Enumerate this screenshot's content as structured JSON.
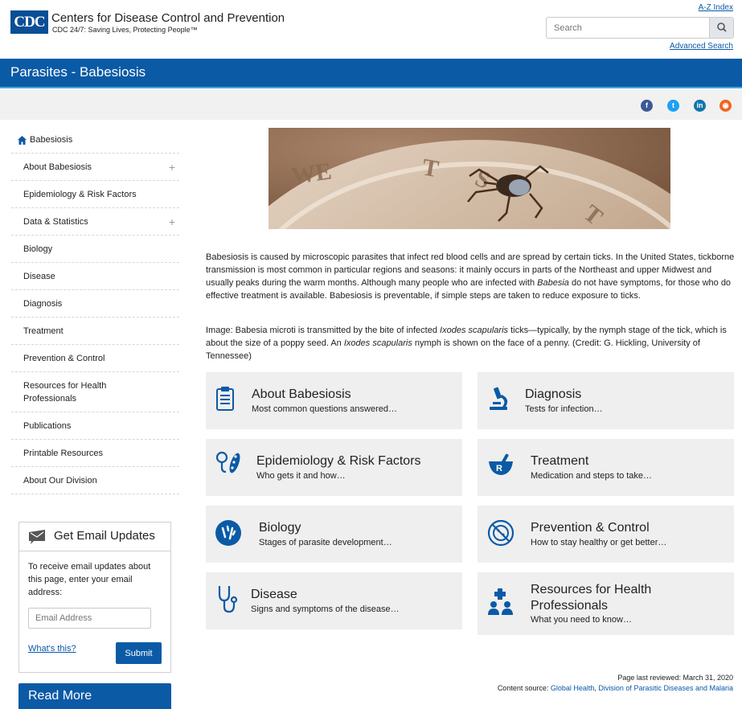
{
  "header": {
    "logo_text": "CDC",
    "org_name": "Centers for Disease Control and Prevention",
    "tagline": "CDC 24/7: Saving Lives, Protecting People™",
    "az_index": "A-Z Index",
    "search_placeholder": "Search",
    "advanced_search": "Advanced Search"
  },
  "band": {
    "title": "Parasites - Babesiosis",
    "color": "#0b5aa6"
  },
  "social": [
    "facebook-icon",
    "twitter-icon",
    "linkedin-icon",
    "syndicate-icon"
  ],
  "sidebar": {
    "home": "Babesiosis",
    "items": [
      {
        "label": "About Babesiosis"
      },
      {
        "label": "Epidemiology & Risk Factors"
      },
      {
        "label": "Data & Statistics"
      },
      {
        "label": "Biology"
      },
      {
        "label": "Disease"
      },
      {
        "label": "Diagnosis"
      },
      {
        "label": "Treatment"
      },
      {
        "label": "Prevention & Control"
      },
      {
        "label": "Resources for Health Professionals"
      },
      {
        "label": "Publications"
      },
      {
        "label": "Printable Resources"
      },
      {
        "label": "About Our Division"
      }
    ],
    "expand_symbol": "+"
  },
  "email": {
    "title": "Get Email Updates",
    "body": "To receive email updates about this page, enter your email address:",
    "placeholder": "Email Address",
    "whats_this": "What's this?",
    "submit": "Submit"
  },
  "read_more": "Read More",
  "main": {
    "intro_1": "Babesiosis is caused by microscopic parasites that infect red blood cells and are spread by certain ticks. In the United States, tickborne transmission is most common in particular regions and seasons: it mainly occurs in parts of the Northeast and upper Midwest and usually peaks during the warm months. Although many people who are infected with ",
    "intro_em": "Babesia",
    "intro_2": " do not have symptoms, for those who do effective treatment is available. Babesiosis is preventable, if simple steps are taken to reduce exposure to ticks.",
    "caption_1": "Image: Babesia microti is transmitted by the bite of infected ",
    "caption_em1": "Ixodes scapularis",
    "caption_2": " ticks—typically, by the nymph stage of the tick, which is about the size of a poppy seed. An ",
    "caption_em2": "Ixodes scapularis",
    "caption_3": " nymph is shown on the face of a penny. (Credit: G. Hickling, University of Tennessee)",
    "cards": [
      {
        "title": "About Babesiosis",
        "sub": "Most common questions answered…"
      },
      {
        "title": "Diagnosis",
        "sub": "Tests for infection…"
      },
      {
        "title": "Epidemiology & Risk Factors",
        "sub": "Who gets it and how…"
      },
      {
        "title": "Treatment",
        "sub": "Medication and steps to take…"
      },
      {
        "title": "Biology",
        "sub": "Stages of parasite development…"
      },
      {
        "title": "Prevention & Control",
        "sub": "How to stay healthy or get better…"
      },
      {
        "title": "Disease",
        "sub": "Signs and symptoms of the disease…"
      },
      {
        "title_1": "Resources for Health",
        "title_2": "Professionals",
        "sub": "What you need to know…"
      }
    ]
  },
  "footer": {
    "reviewed": "Page last reviewed: March 31, 2020",
    "source_label": "Content source: ",
    "source_link_1": "Global Health",
    "separator": ", ",
    "source_link_2": "Division of Parasitic Diseases and Malaria"
  },
  "colors": {
    "accent": "#0b5aa6",
    "link": "#0a58a8",
    "card_bg": "#efefef"
  }
}
